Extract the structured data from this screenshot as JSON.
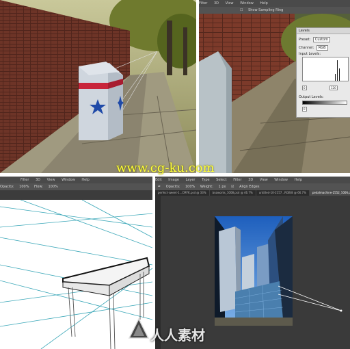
{
  "watermark": "www.cg-ku.com",
  "logo_text": "人人素材",
  "top_right": {
    "menu": [
      "Filter",
      "3D",
      "View",
      "Window",
      "Help"
    ],
    "option_toggle": "Show Sampling Ring",
    "levels": {
      "title": "Levels",
      "preset_label": "Preset:",
      "preset_value": "Custom",
      "channel_label": "Channel:",
      "channel_value": "RGB",
      "input_label": "Input Levels:",
      "input_black": "0",
      "input_white": "120",
      "output_label": "Output Levels:",
      "output_black": "0"
    }
  },
  "bottom_left": {
    "menu": [
      "Filter",
      "3D",
      "View",
      "Window",
      "Help"
    ],
    "options": [
      "Opacity:",
      "100%",
      "Flow:",
      "100%"
    ]
  },
  "bottom_right": {
    "menu": [
      "Edit",
      "Image",
      "Layer",
      "Type",
      "Select",
      "Filter",
      "3D",
      "View",
      "Window",
      "Help"
    ],
    "options": [
      "Opacity:",
      "100%",
      "Weight:",
      "1 px",
      "Align Edges"
    ],
    "tabs": [
      {
        "label": "perfect-sweet-1...CMYK.psd @ 33%",
        "active": false
      },
      {
        "label": "bnaworks_1008.psd @ 46.7%",
        "active": false
      },
      {
        "label": "untitled-10-2157...RGB/8 @ 66.7%",
        "active": false
      },
      {
        "label": "pedalmachine-2552_1006.psd @ 36...",
        "active": true
      }
    ]
  }
}
